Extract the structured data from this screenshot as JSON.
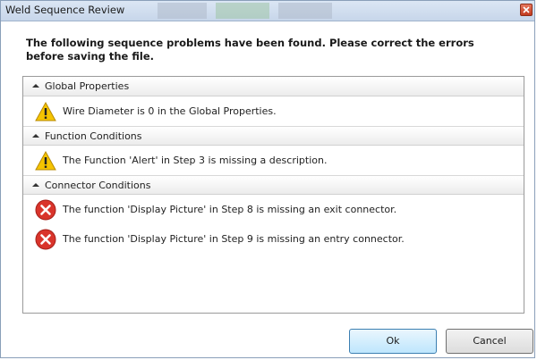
{
  "window": {
    "title": "Weld Sequence Review"
  },
  "message": "The following sequence problems have been found.   Please correct the errors before saving the file.",
  "groups": [
    {
      "label": "Global Properties",
      "items": [
        {
          "severity": "warning",
          "icon": "warning-icon",
          "text": "Wire Diameter is 0 in the Global Properties."
        }
      ]
    },
    {
      "label": "Function Conditions",
      "items": [
        {
          "severity": "warning",
          "icon": "warning-icon",
          "text": "The Function 'Alert' in Step 3 is missing a description."
        }
      ]
    },
    {
      "label": "Connector Conditions",
      "items": [
        {
          "severity": "error",
          "icon": "error-icon",
          "text": "The function 'Display Picture' in Step 8 is missing an exit connector."
        },
        {
          "severity": "error",
          "icon": "error-icon",
          "text": "The function 'Display Picture' in Step 9 is missing an entry connector."
        }
      ]
    }
  ],
  "buttons": {
    "ok": "Ok",
    "cancel": "Cancel"
  },
  "colors": {
    "warning": "#f5c400",
    "error": "#d9342b",
    "titlebar": "#cfdcee"
  }
}
